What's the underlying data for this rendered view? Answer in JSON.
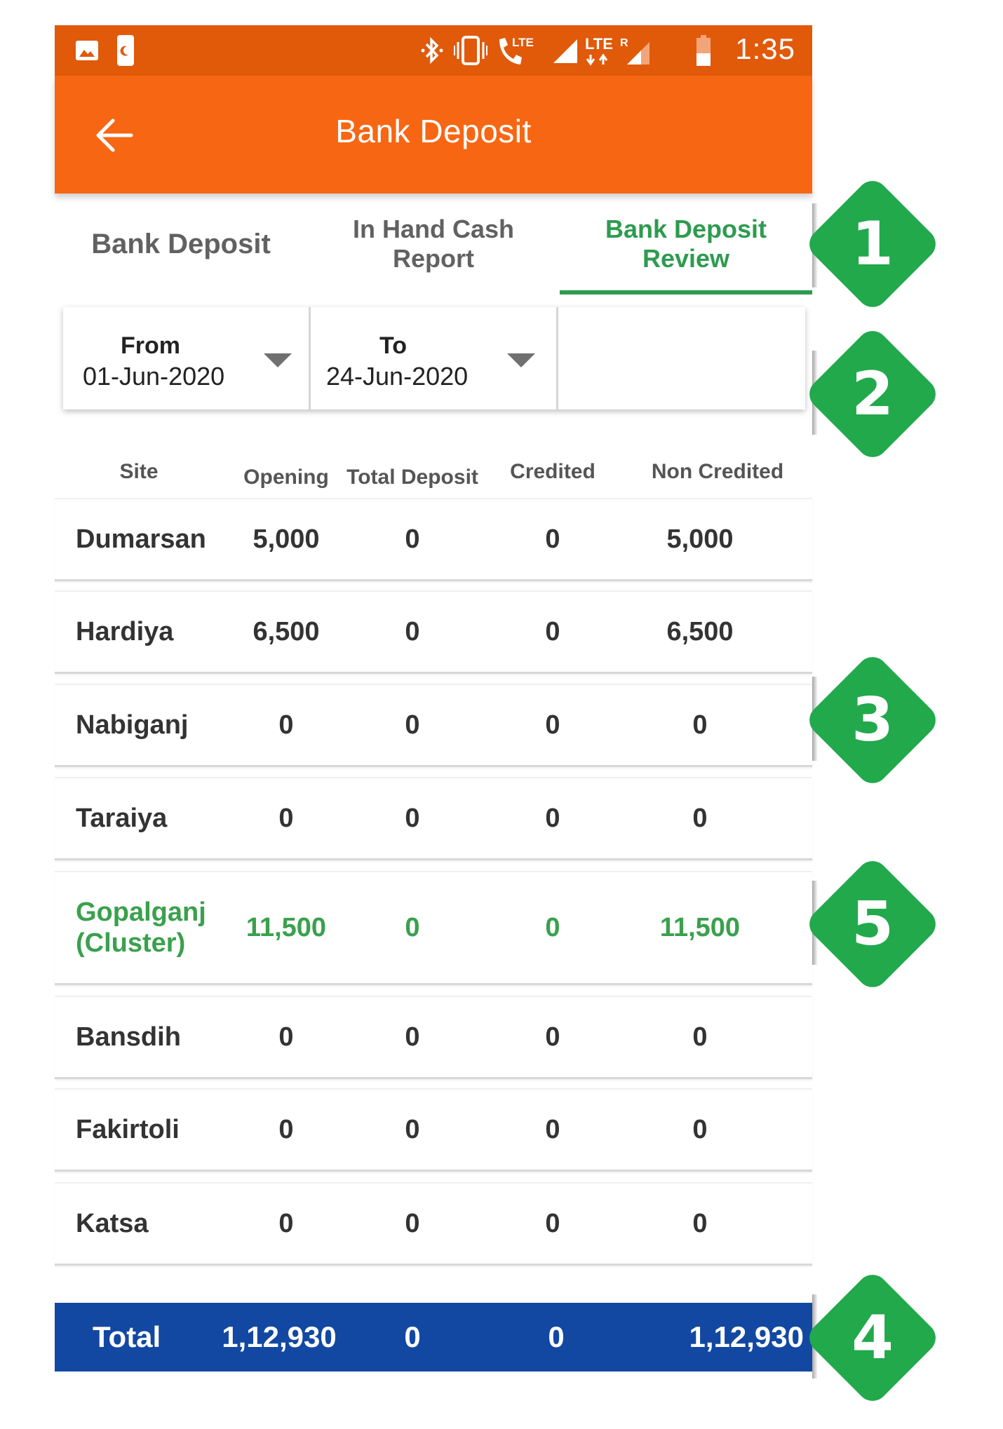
{
  "status_bar": {
    "time": "1:35",
    "left_icons": [
      "image-icon",
      "night-mode-icon"
    ],
    "right_icons": [
      "bluetooth-icon",
      "vibrate-icon",
      "lte-call-icon",
      "signal-icon",
      "lte-data-icon",
      "roaming-signal-icon",
      "battery-icon"
    ],
    "lte_label": "LTE",
    "roaming_label": "R"
  },
  "toolbar": {
    "title": "Bank Deposit",
    "back_icon": "arrow-left-icon"
  },
  "tabs": [
    {
      "label": "Bank Deposit",
      "active": false
    },
    {
      "label": "In Hand Cash Report",
      "line1": "In Hand Cash",
      "line2": "Report",
      "active": false
    },
    {
      "label": "Bank Deposit Review",
      "line1": "Bank Deposit",
      "line2": "Review",
      "active": true
    }
  ],
  "filter": {
    "from": {
      "label": "From",
      "value": "01-Jun-2020"
    },
    "to": {
      "label": "To",
      "value": "24-Jun-2020"
    }
  },
  "table": {
    "headers": [
      "Site",
      "Opening",
      "Total Deposit",
      "Credited",
      "Non Credited"
    ],
    "rows": [
      {
        "site": "Dumarsan",
        "opening": "5,000",
        "total_deposit": "0",
        "credited": "0",
        "non_credited": "5,000",
        "highlight": false
      },
      {
        "site": "Hardiya",
        "opening": "6,500",
        "total_deposit": "0",
        "credited": "0",
        "non_credited": "6,500",
        "highlight": false
      },
      {
        "site": "Nabiganj",
        "opening": "0",
        "total_deposit": "0",
        "credited": "0",
        "non_credited": "0",
        "highlight": false
      },
      {
        "site": "Taraiya",
        "opening": "0",
        "total_deposit": "0",
        "credited": "0",
        "non_credited": "0",
        "highlight": false
      },
      {
        "site": "Gopalganj (Cluster)",
        "site_line1": "Gopalganj",
        "site_line2": "(Cluster)",
        "opening": "11,500",
        "total_deposit": "0",
        "credited": "0",
        "non_credited": "11,500",
        "highlight": true
      },
      {
        "site": "Bansdih",
        "opening": "0",
        "total_deposit": "0",
        "credited": "0",
        "non_credited": "0",
        "highlight": false
      },
      {
        "site": "Fakirtoli",
        "opening": "0",
        "total_deposit": "0",
        "credited": "0",
        "non_credited": "0",
        "highlight": false
      },
      {
        "site": "Katsa",
        "opening": "0",
        "total_deposit": "0",
        "credited": "0",
        "non_credited": "0",
        "highlight": false
      }
    ],
    "total": {
      "label": "Total",
      "opening": "1,12,930",
      "total_deposit": "0",
      "credited": "0",
      "non_credited": "1,12,930"
    }
  },
  "callouts": [
    "1",
    "2",
    "3",
    "4",
    "5"
  ],
  "colors": {
    "status_bar": "#e05a0a",
    "toolbar": "#f76713",
    "active_tab": "#2e9b4f",
    "highlight_row": "#3aa04d",
    "total_bar": "#1248a2",
    "callout": "#21a94c"
  }
}
